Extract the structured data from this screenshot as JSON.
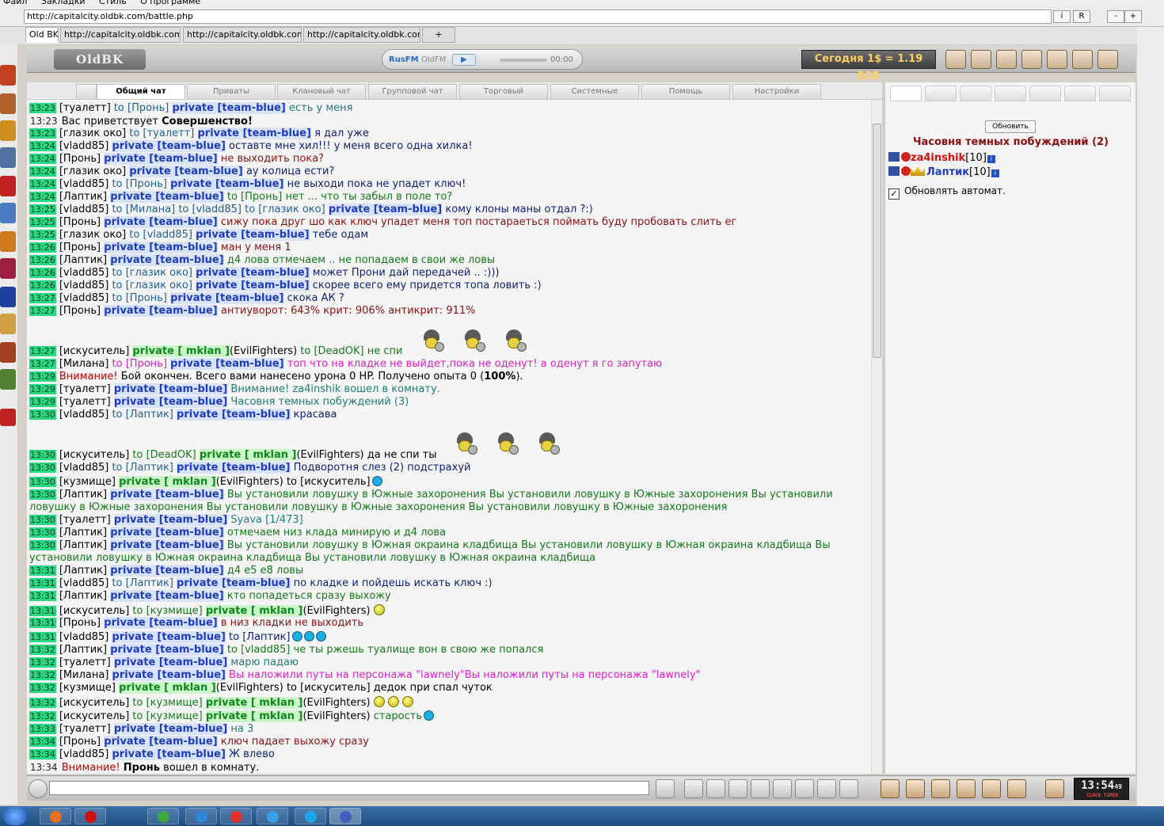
{
  "browser": {
    "menu": [
      "Файл",
      "Закладки",
      "Стиль",
      "О программе"
    ],
    "url": "http://capitalcity.oldbk.com/battle.php",
    "btn_i": "i",
    "btn_r": "R",
    "btn_minus": "-",
    "btn_plus": "+",
    "tabs": [
      "Old BK",
      "http://capitalcity.oldbk.com/m",
      "http://capitalcity.oldbk.com/r",
      "http://capitalcity.oldbk.com/l",
      "+"
    ]
  },
  "header": {
    "logo": "OldBK",
    "radio_rus": "RusFM",
    "radio_old": "OldFM",
    "radio_play": "▶",
    "radio_time": "00:00",
    "rate": "Сегодня 1$ = 1.19 ECR"
  },
  "chat_tabs": [
    "Общий чат",
    "Приваты",
    "Клановый чат",
    "Групповой чат",
    "Торговый",
    "Системные",
    "Помощь",
    "Настройки"
  ],
  "chat": {
    "l1": {
      "t": "13:23",
      "n": "[туалетт]",
      "to": "to [Пронь]",
      "p": "private [team-blue]",
      "m": "есть у меня"
    },
    "l2": {
      "t": "13:23",
      "m": "Вас приветствует",
      "b": "Совершенство!"
    },
    "l3": {
      "t": "13:23",
      "n": "[глазик око]",
      "to": "to [туалетт]",
      "p": "private [team-blue]",
      "m": "я дал уже"
    },
    "l4": {
      "t": "13:24",
      "n": "[vladd85]",
      "p": "private [team-blue]",
      "m": "оставте мне хил!!! у меня всего одна хилка!"
    },
    "l5": {
      "t": "13:24",
      "n": "[Пронь]",
      "p": "private [team-blue]",
      "m": "не выходить пока?"
    },
    "l6": {
      "t": "13:24",
      "n": "[глазик око]",
      "p": "private [team-blue]",
      "m": "ау колица ести?"
    },
    "l7": {
      "t": "13:24",
      "n": "[vladd85]",
      "to": "to [Пронь]",
      "p": "private [team-blue]",
      "m": "не выходи пока не упадет ключ!"
    },
    "l8": {
      "t": "13:24",
      "n": "[Лаптик]",
      "p": "private [team-blue]",
      "m": "to [Пронь] нет ... что ты забыл в поле то?"
    },
    "l9": {
      "t": "13:25",
      "n": "[vladd85]",
      "to": "to [Милана]",
      "to2": "to [vladd85]",
      "to3": "to [глазик око]",
      "p": "private [team-blue]",
      "m": "кому клоны маны отдал ?:)"
    },
    "l10": {
      "t": "13:25",
      "n": "[Пронь]",
      "p": "private [team-blue]",
      "m": "сижу пока друг шо как ключ упадет меня топ постараеться поймать буду пробовать слить ег"
    },
    "l11": {
      "t": "13:25",
      "n": "[глазик око]",
      "to": "to [vladd85]",
      "p": "private [team-blue]",
      "m": "тебе одам"
    },
    "l12": {
      "t": "13:26",
      "n": "[Пронь]",
      "p": "private [team-blue]",
      "m": "ман у меня 1"
    },
    "l13": {
      "t": "13:26",
      "n": "[Лаптик]",
      "p": "private [team-blue]",
      "m": "д4 лова отмечаем .. не попадаем в свои же ловы"
    },
    "l14": {
      "t": "13:26",
      "n": "[vladd85]",
      "to": "to [глазик око]",
      "p": "private [team-blue]",
      "m": "может Прони дай передачей .. :)))"
    },
    "l15": {
      "t": "13:26",
      "n": "[vladd85]",
      "to": "to [глазик око]",
      "p": "private [team-blue]",
      "m": "скорее всего ему придется топа ловить :)"
    },
    "l16": {
      "t": "13:27",
      "n": "[vladd85]",
      "to": "to [Пронь]",
      "p": "private [team-blue]",
      "m": "скока АК ?"
    },
    "l17": {
      "t": "13:27",
      "n": "[Пронь]",
      "p": "private [team-blue]",
      "m": "антиуворот: 643% крит: 906% антикрит: 911%"
    },
    "l18": {
      "t": "13:27",
      "n": "[искуситель]",
      "p": "private [ mklan ]",
      "g": "(EvilFighters)",
      "to": "to [DeadOK]",
      "m": "не спи"
    },
    "l19": {
      "t": "13:27",
      "n": "[Милана]",
      "to": "to [Пронь]",
      "p": "private [team-blue]",
      "m": "топ что на кладке не выйдет,пока не оденут! а оденут я го запутаю"
    },
    "l20": {
      "t": "13:29",
      "w": "Внимание!",
      "m": "Бой окончен. Всего вами нанесено урона 0 HP. Получено опыта 0 (",
      "b": "100%",
      "m2": ")."
    },
    "l21": {
      "t": "13:29",
      "n": "[туалетт]",
      "p": "private [team-blue]",
      "m": "Внимание! za4inshik вошел в комнату."
    },
    "l22": {
      "t": "13:29",
      "n": "[туалетт]",
      "p": "private [team-blue]",
      "m": "Часовня темных побуждений (3)"
    },
    "l23": {
      "t": "13:30",
      "n": "[vladd85]",
      "to": "to [Лаптик]",
      "p": "private [team-blue]",
      "m": "красава"
    },
    "l24": {
      "t": "13:30",
      "n": "[искуситель]",
      "to": "to [DeadOK]",
      "p": "private [ mklan ]",
      "g": "(EvilFighters)",
      "m": "да не спи ты"
    },
    "l25": {
      "t": "13:30",
      "n": "[vladd85]",
      "to": "to [Лаптик]",
      "p": "private [team-blue]",
      "m": "Подворотня слез (2) подстрахуй"
    },
    "l26": {
      "t": "13:30",
      "n": "[кузмище]",
      "p": "private [ mklan ]",
      "g": "(EvilFighters)",
      "m": "to [искуситель]"
    },
    "l27": {
      "t": "13:30",
      "n": "[Лаптик]",
      "p": "private [team-blue]",
      "m": "Вы установили ловушку в Южные захоронения Вы установили ловушку в Южные захоронения Вы установили",
      "m2": "ловушку в Южные захоронения Вы установили ловушку в Южные захоронения Вы установили ловушку в Южные захоронения"
    },
    "l28": {
      "t": "13:30",
      "n": "[туалетт]",
      "p": "private [team-blue]",
      "m": "Syava [1/473]"
    },
    "l29": {
      "t": "13:30",
      "n": "[Лаптик]",
      "p": "private [team-blue]",
      "m": "отмечаем низ клада минирую и д4 лова"
    },
    "l30": {
      "t": "13:30",
      "n": "[Лаптик]",
      "p": "private [team-blue]",
      "m": "Вы установили ловушку в Южная окраина кладбища Вы установили ловушку в Южная окраина кладбища Вы",
      "m2": "установили ловушку в Южная окраина кладбища Вы установили ловушку в Южная окраина кладбища"
    },
    "l31": {
      "t": "13:31",
      "n": "[Лаптик]",
      "p": "private [team-blue]",
      "m": "д4 е5 е8 ловы"
    },
    "l32": {
      "t": "13:31",
      "n": "[vladd85]",
      "to": "to [Лаптик]",
      "p": "private [team-blue]",
      "m": "по кладке и пойдешь искать ключ :)"
    },
    "l33": {
      "t": "13:31",
      "n": "[Лаптик]",
      "p": "private [team-blue]",
      "m": "кто попадеться сразу выхожу"
    },
    "l34": {
      "t": "13:31",
      "n": "[искуситель]",
      "to": "to [кузмище]",
      "p": "private [ mklan ]",
      "g": "(EvilFighters)"
    },
    "l35": {
      "t": "13:31",
      "n": "[Пронь]",
      "p": "private [team-blue]",
      "m": "в низ кладки не выходить"
    },
    "l36": {
      "t": "13:31",
      "n": "[vladd85]",
      "p": "private [team-blue]",
      "m": "to [Лаптик]"
    },
    "l37": {
      "t": "13:32",
      "n": "[Лаптик]",
      "p": "private [team-blue]",
      "m": "to [vladd85] че ты ржешь туалище вон в свою же попался"
    },
    "l38": {
      "t": "13:32",
      "n": "[туалетт]",
      "p": "private [team-blue]",
      "m": "марю падаю"
    },
    "l39": {
      "t": "13:32",
      "n": "[Милана]",
      "p": "private [team-blue]",
      "m": "Вы наложили путы на персонажа \"lawnely\"Вы наложили путы на персонажа \"lawnely\""
    },
    "l40": {
      "t": "13:32",
      "n": "[кузмище]",
      "p": "private [ mklan ]",
      "g": "(EvilFighters)",
      "m": "to [искуситель] дедок при спал чуток"
    },
    "l41": {
      "t": "13:32",
      "n": "[искуситель]",
      "to": "to [кузмище]",
      "p": "private [ mklan ]",
      "g": "(EvilFighters)"
    },
    "l42": {
      "t": "13:32",
      "n": "[искуситель]",
      "to": "to [кузмище]",
      "p": "private [ mklan ]",
      "g": "(EvilFighters)",
      "m": "старость"
    },
    "l43": {
      "t": "13:33",
      "n": "[туалетт]",
      "p": "private [team-blue]",
      "m": "на 3"
    },
    "l44": {
      "t": "13:34",
      "n": "[Пронь]",
      "p": "private [team-blue]",
      "m": "ключ падает выхожу сразу"
    },
    "l45": {
      "t": "13:34",
      "n": "[vladd85]",
      "p": "private [team-blue]",
      "m": "Ж влево"
    },
    "l46": {
      "t": "13:34",
      "w": "Внимание!",
      "b": "Пронь",
      "m": "вошел в комнату."
    }
  },
  "panel": {
    "refresh": "Обновить",
    "room": "Часовня темных побуждений (2)",
    "users": [
      {
        "name": "za4inshik",
        "level": "[10]"
      },
      {
        "name": "Лаптик",
        "level": "[10]"
      }
    ],
    "info": "i",
    "auto_check": "✓",
    "auto_update": "Обновлять автомат."
  },
  "clock": {
    "time": "13:54",
    "sec": "49",
    "label": "CLOCK TIMER"
  },
  "colors": {
    "timestamp": "#29d882",
    "private_blue": "#1d3cc2",
    "private_green": "#0b8a18",
    "warning": "#c00000",
    "room": "#8b0e0e"
  }
}
